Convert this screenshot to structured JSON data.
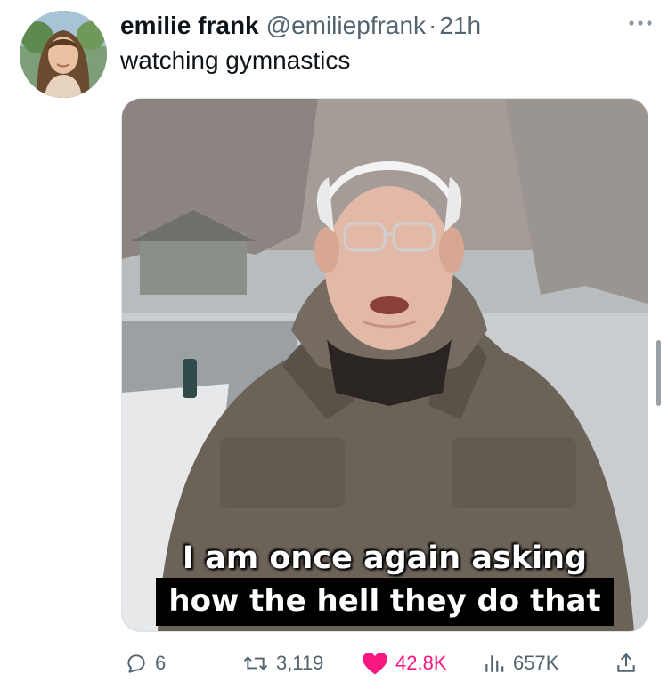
{
  "tweet": {
    "author_name": "emilie frank",
    "handle": "@emiliepfrank",
    "separator": "·",
    "time": "21h",
    "text": "watching gymnastics"
  },
  "media": {
    "caption_line1": "I am once again asking",
    "caption_line2": "how the hell they do that"
  },
  "actions": {
    "replies": "6",
    "retweets": "3,119",
    "likes": "42.8K",
    "views": "657K"
  },
  "icons": {
    "reply": "speech-bubble-icon",
    "retweet": "retweet-arrows-icon",
    "like": "heart-icon",
    "views": "bar-chart-icon",
    "share": "share-upload-icon",
    "more": "more-dots-icon"
  },
  "colors": {
    "like_pink": "#f91880",
    "secondary_text": "#536471",
    "primary_text": "#0f1419"
  }
}
